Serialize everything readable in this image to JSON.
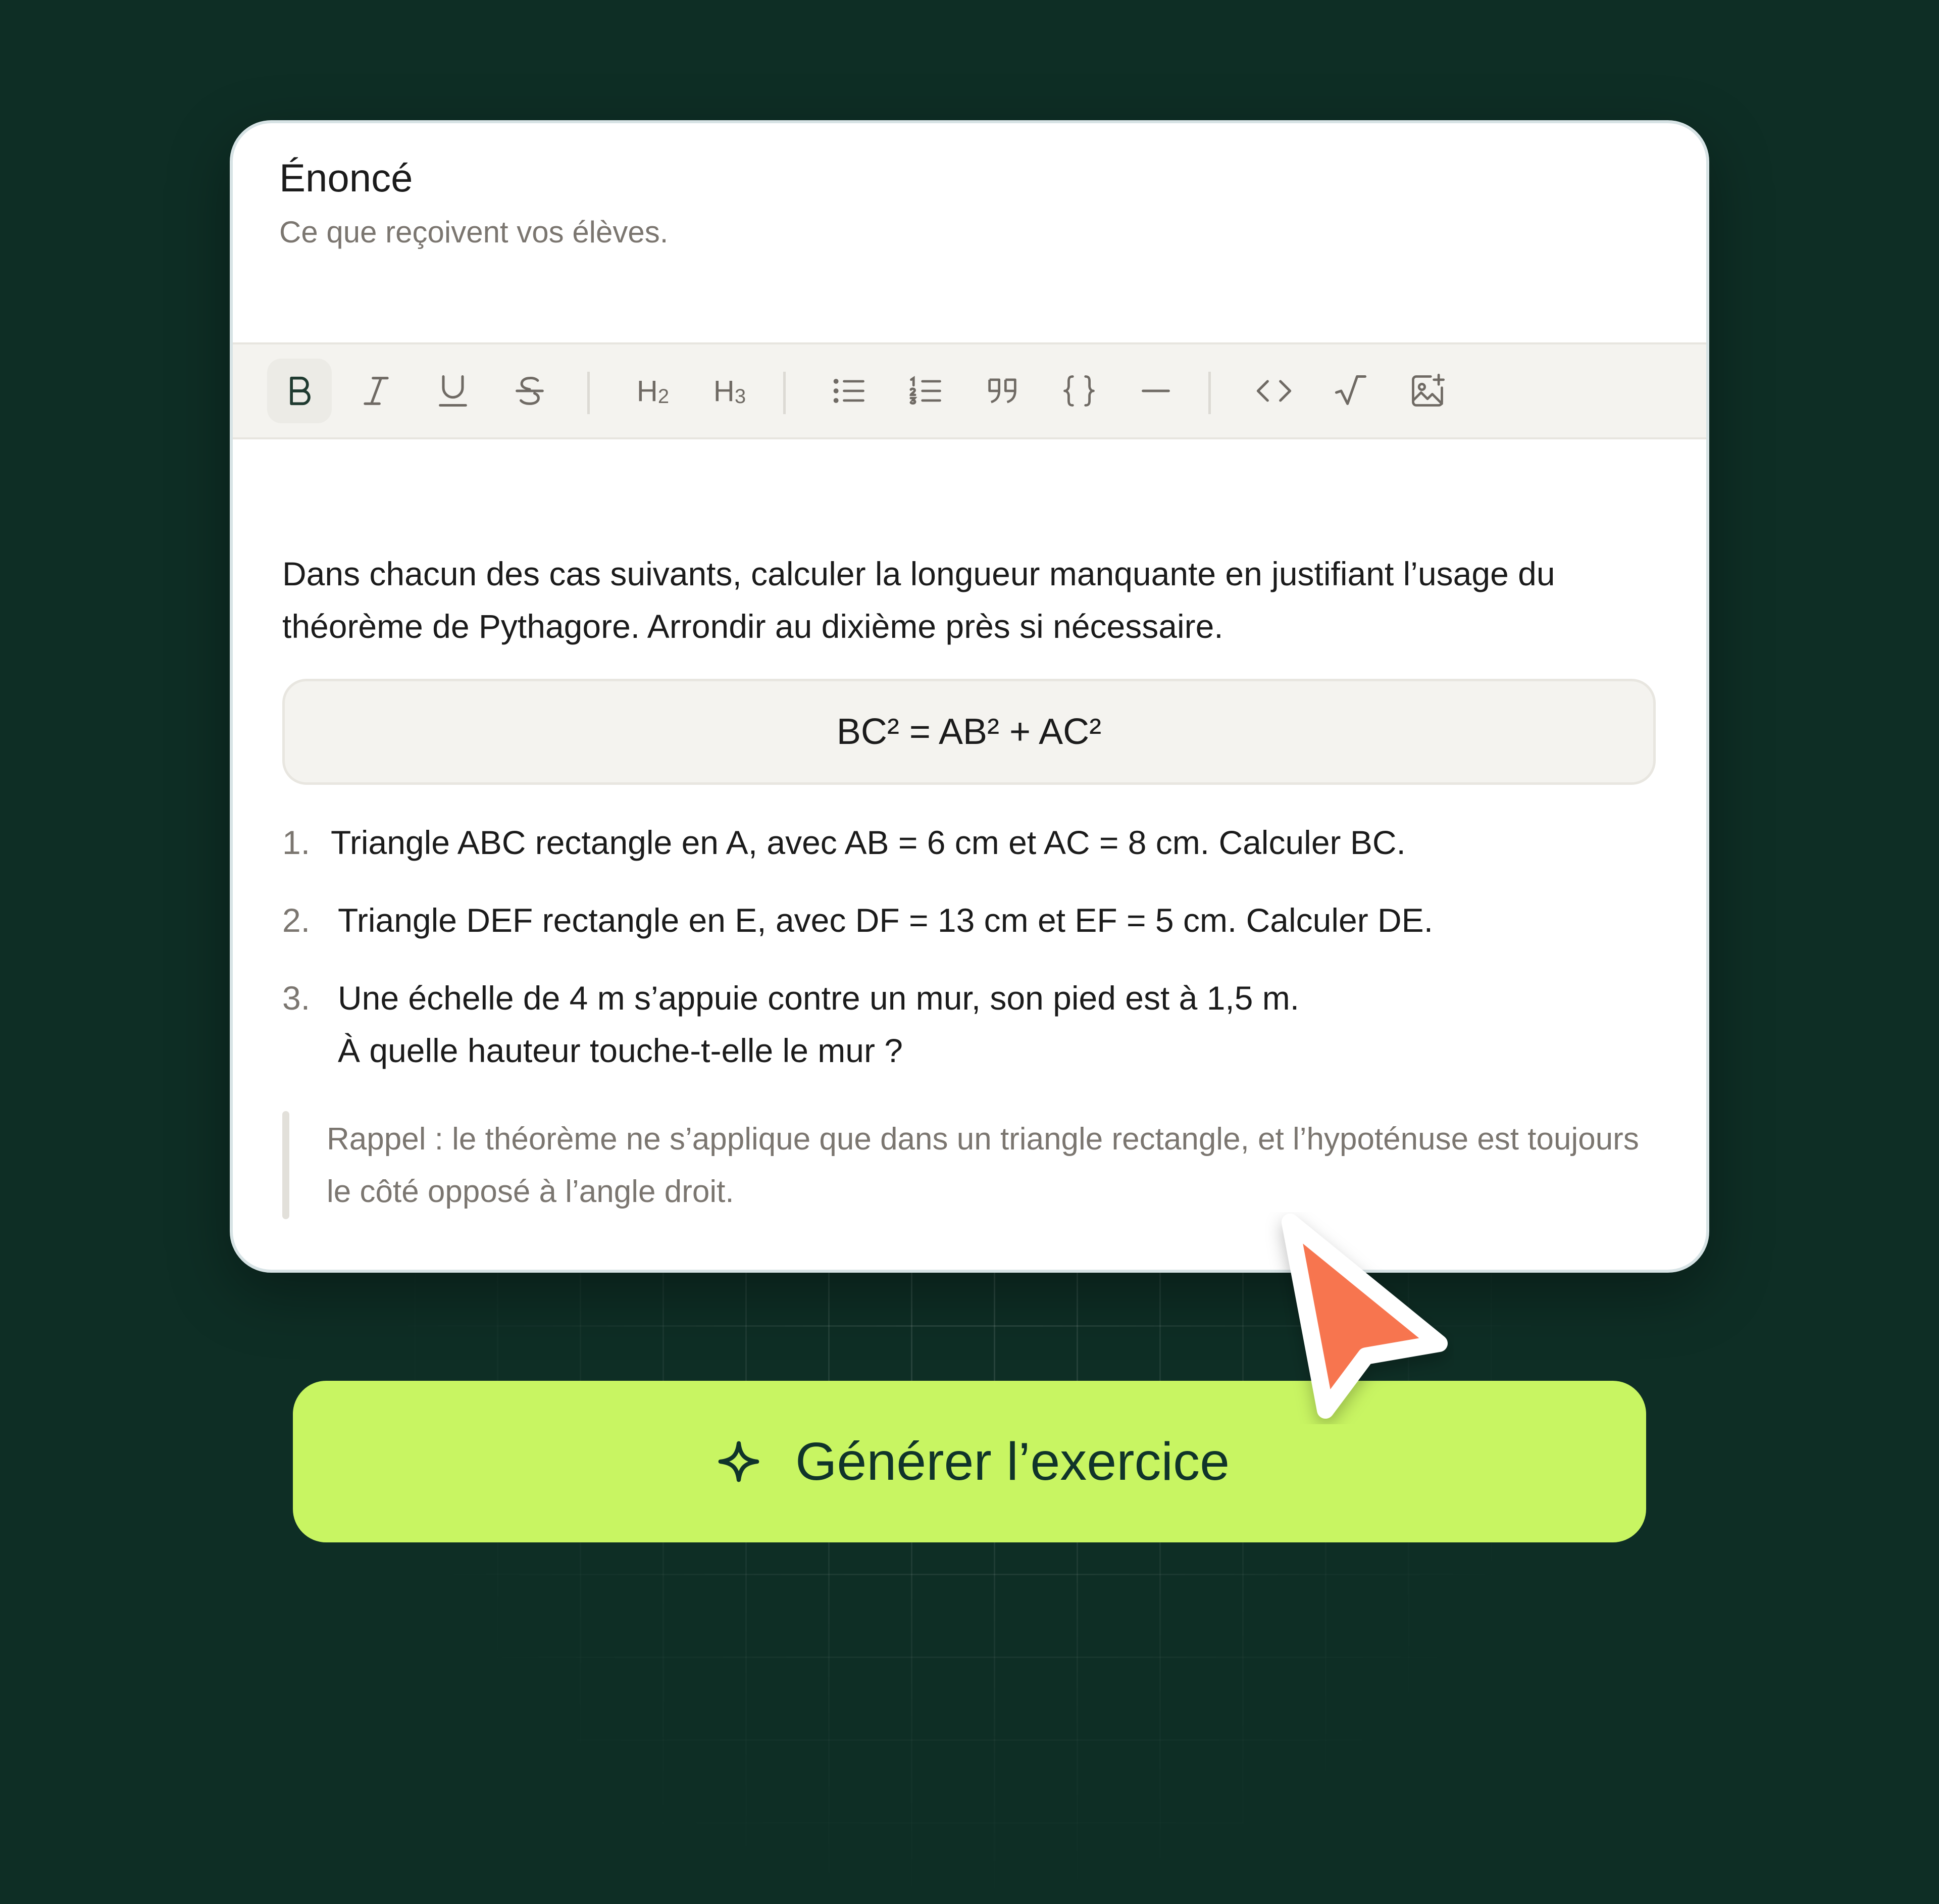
{
  "card": {
    "title": "Énoncé",
    "subtitle": "Ce que reçoivent vos élèves."
  },
  "toolbar": {
    "buttons": [
      {
        "name": "bold",
        "icon": "bold-icon",
        "active": true
      },
      {
        "name": "italic",
        "icon": "italic-icon"
      },
      {
        "name": "underline",
        "icon": "underline-icon"
      },
      {
        "name": "strikethrough",
        "icon": "strikethrough-icon"
      },
      {
        "name": "heading-2",
        "label": "H",
        "sub": "2"
      },
      {
        "name": "heading-3",
        "label": "H",
        "sub": "3"
      },
      {
        "name": "bullet-list",
        "icon": "bullet-list-icon"
      },
      {
        "name": "numbered-list",
        "icon": "numbered-list-icon"
      },
      {
        "name": "quote",
        "icon": "quote-icon"
      },
      {
        "name": "code-block",
        "icon": "braces-icon"
      },
      {
        "name": "horizontal-rule",
        "icon": "horizontal-rule-icon"
      },
      {
        "name": "inline-code",
        "icon": "code-icon"
      },
      {
        "name": "math",
        "icon": "square-root-icon"
      },
      {
        "name": "insert-image",
        "icon": "image-add-icon"
      }
    ]
  },
  "content": {
    "intro": "Dans chacun des cas suivants, calculer la longueur manquante en justifiant l’usage du théorème de Pythagore. Arrondir au dixième près si nécessaire.",
    "formula": "BC² = AB² + AC²",
    "items": [
      {
        "num": "1.",
        "lines": [
          "Triangle ABC rectangle en A, avec AB = 6 cm et AC = 8 cm. Calculer BC."
        ]
      },
      {
        "num": "2.",
        "lines": [
          "Triangle DEF rectangle en E, avec DF = 13 cm et EF = 5 cm. Calculer DE."
        ]
      },
      {
        "num": "3.",
        "lines": [
          "Une échelle de 4 m s’appuie contre un mur, son pied est à 1,5 m.",
          "À quelle hauteur touche-t-elle le mur ?"
        ]
      }
    ],
    "quote": "Rappel : le théorème ne s’applique que dans un triangle rectangle, et l’hypoténuse est toujours le côté opposé à l’angle droit."
  },
  "generate_button": {
    "label": "Générer l’exercice",
    "icon": "sparkle-icon"
  },
  "colors": {
    "background": "#0e2e25",
    "button": "#c8f562",
    "cursor": "#f7754f"
  }
}
